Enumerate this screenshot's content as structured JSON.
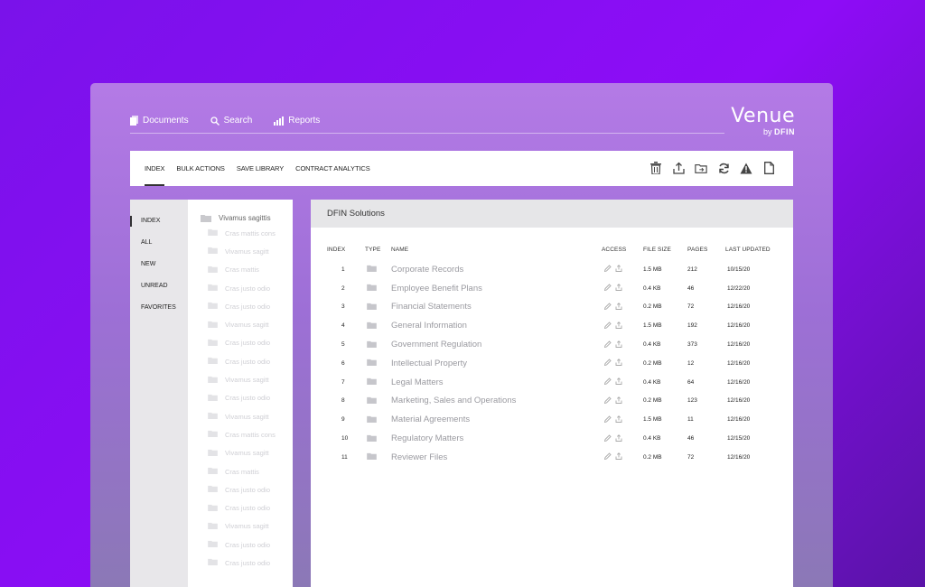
{
  "topnav": {
    "items": [
      {
        "label": "Documents",
        "icon": "documents-icon"
      },
      {
        "label": "Search",
        "icon": "search-icon"
      },
      {
        "label": "Reports",
        "icon": "bar-chart-icon"
      }
    ]
  },
  "brand": {
    "name": "Venue",
    "by": "by",
    "company": "DFIN"
  },
  "toolbar": {
    "tabs": [
      "INDEX",
      "BULK ACTIONS",
      "SAVE LIBRARY",
      "CONTRACT ANALYTICS"
    ],
    "icons": [
      "trash-icon",
      "upload-icon",
      "folder-move-icon",
      "refresh-icon",
      "warning-icon",
      "document-icon"
    ]
  },
  "leftnav": {
    "items": [
      "INDEX",
      "ALL",
      "NEW",
      "UNREAD",
      "FAVORITES"
    ]
  },
  "tree": {
    "root": "Vivamus sagittis",
    "items": [
      "Cras mattis cons",
      "Vivamus sagitt",
      "Cras mattis",
      "Cras justo odio",
      "Cras justo odio",
      "Vivamus sagitt",
      "Cras justo odio",
      "Cras justo odio",
      "Vivamus sagitt",
      "Cras justo odio",
      "Vivamus sagitt",
      "Cras mattis cons",
      "Vivamus sagitt",
      "Cras mattis",
      "Cras justo odio",
      "Cras justo odio",
      "Vivamus sagitt",
      "Cras justo odio",
      "Cras justo odio"
    ]
  },
  "main": {
    "title": "DFIN Solutions",
    "columns": {
      "index": "INDEX",
      "type": "TYPE",
      "name": "NAME",
      "access": "ACCESS",
      "size": "FILE SIZE",
      "pages": "PAGES",
      "updated": "LAST UPDATED"
    },
    "rows": [
      {
        "index": "1",
        "name": "Corporate Records",
        "size": "1.5 MB",
        "pages": "212",
        "updated": "10/15/20"
      },
      {
        "index": "2",
        "name": "Employee Benefit Plans",
        "size": "0.4 KB",
        "pages": "46",
        "updated": "12/22/20"
      },
      {
        "index": "3",
        "name": "Financial Statements",
        "size": "0.2 MB",
        "pages": "72",
        "updated": "12/16/20"
      },
      {
        "index": "4",
        "name": "General Information",
        "size": "1.5 MB",
        "pages": "192",
        "updated": "12/16/20"
      },
      {
        "index": "5",
        "name": "Government Regulation",
        "size": "0.4 KB",
        "pages": "373",
        "updated": "12/16/20"
      },
      {
        "index": "6",
        "name": "Intellectual Property",
        "size": "0.2 MB",
        "pages": "12",
        "updated": "12/16/20"
      },
      {
        "index": "7",
        "name": "Legal Matters",
        "size": "0.4 KB",
        "pages": "64",
        "updated": "12/16/20"
      },
      {
        "index": "8",
        "name": "Marketing, Sales and Operations",
        "size": "0.2 MB",
        "pages": "123",
        "updated": "12/16/20"
      },
      {
        "index": "9",
        "name": "Material Agreements",
        "size": "1.5 MB",
        "pages": "11",
        "updated": "12/16/20"
      },
      {
        "index": "10",
        "name": "Regulatory Matters",
        "size": "0.4 KB",
        "pages": "46",
        "updated": "12/15/20"
      },
      {
        "index": "11",
        "name": "Reviewer Files",
        "size": "0.2 MB",
        "pages": "72",
        "updated": "12/16/20"
      }
    ]
  }
}
